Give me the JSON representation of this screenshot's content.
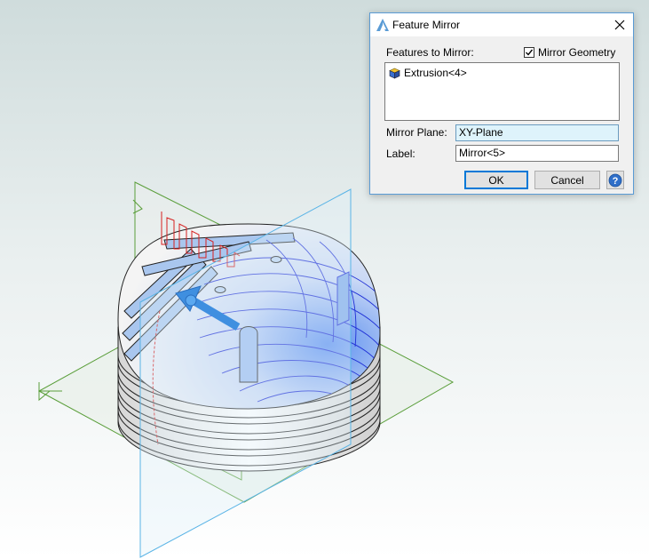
{
  "dialog": {
    "title": "Feature Mirror",
    "features_label": "Features to Mirror:",
    "mirror_geometry_label": "Mirror Geometry",
    "mirror_geometry_checked": true,
    "features": [
      {
        "label": "Extrusion<4>",
        "icon": "feature-cube-icon"
      }
    ],
    "mirror_plane_label": "Mirror Plane:",
    "mirror_plane_value": "XY-Plane",
    "label_label": "Label:",
    "label_value": "Mirror<5>",
    "ok_label": "OK",
    "cancel_label": "Cancel"
  },
  "icons": {
    "app": "app-logo-icon",
    "close": "close-icon",
    "check": "checkmark-icon",
    "help": "help-icon"
  },
  "colors": {
    "dialog_border": "#5a9bd5",
    "selected_field": "#def3fb",
    "default_button_border": "#0078d7",
    "plane_green": "#5a9e3a",
    "plane_cyan": "#5ab4e6",
    "edge_blue": "#1f2fd6",
    "highlight_blue": "#3f8fe0",
    "profile_red": "#d62020"
  }
}
